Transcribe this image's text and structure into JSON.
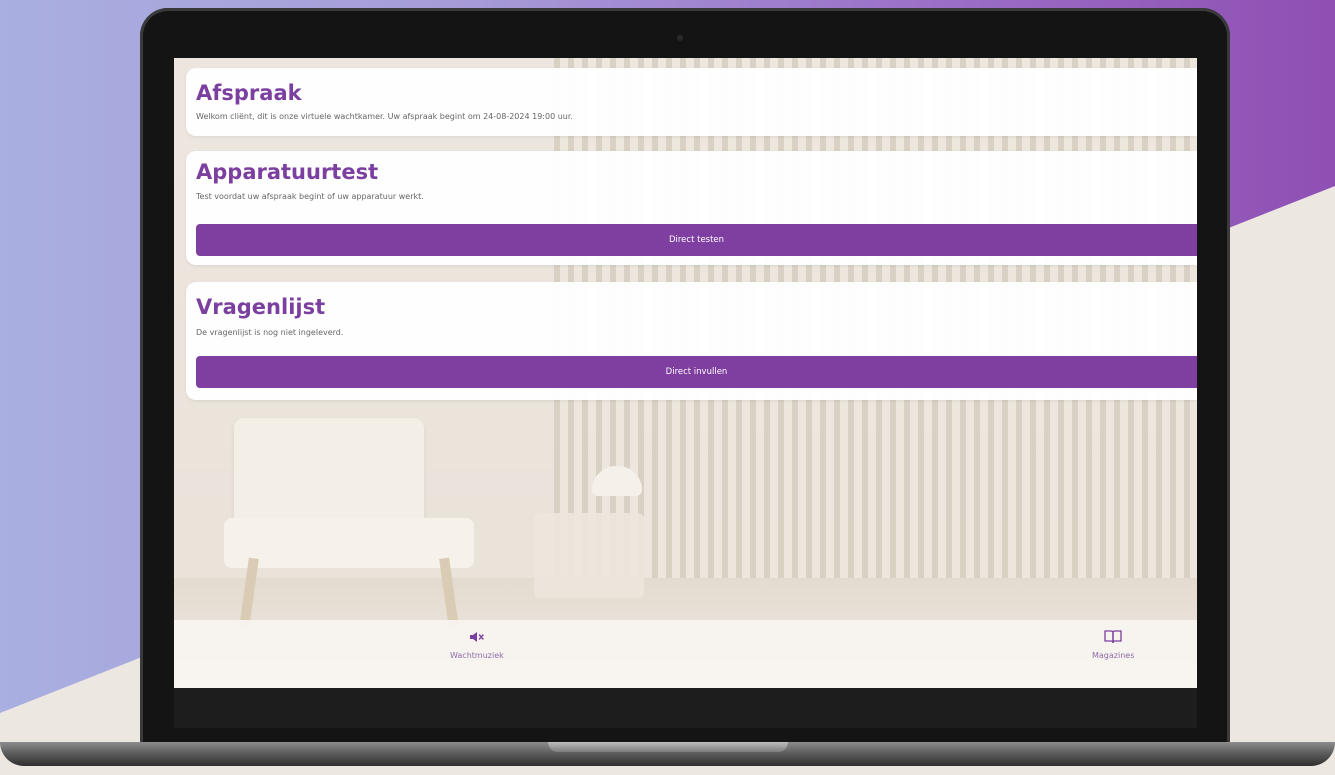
{
  "cards": {
    "afspraak": {
      "title": "Afspraak",
      "text": "Welkom cliënt, dit is onze virtuele wachtkamer. Uw afspraak begint om 24-08-2024 19:00 uur."
    },
    "apparatuurtest": {
      "title": "Apparatuurtest",
      "text": "Test voordat uw afspraak begint of uw apparatuur werkt.",
      "button_label": "Direct testen"
    },
    "vragenlijst": {
      "title": "Vragenlijst",
      "text": "De vragenlijst is nog niet ingeleverd.",
      "button_label": "Direct invullen"
    }
  },
  "footer": {
    "music": {
      "label": "Wachtmuziek",
      "icon": "speaker-muted-icon"
    },
    "magazines": {
      "label": "Magazines",
      "icon": "open-book-icon"
    }
  },
  "colors": {
    "accent": "#7e3fa1",
    "title": "#7b3fa0"
  }
}
